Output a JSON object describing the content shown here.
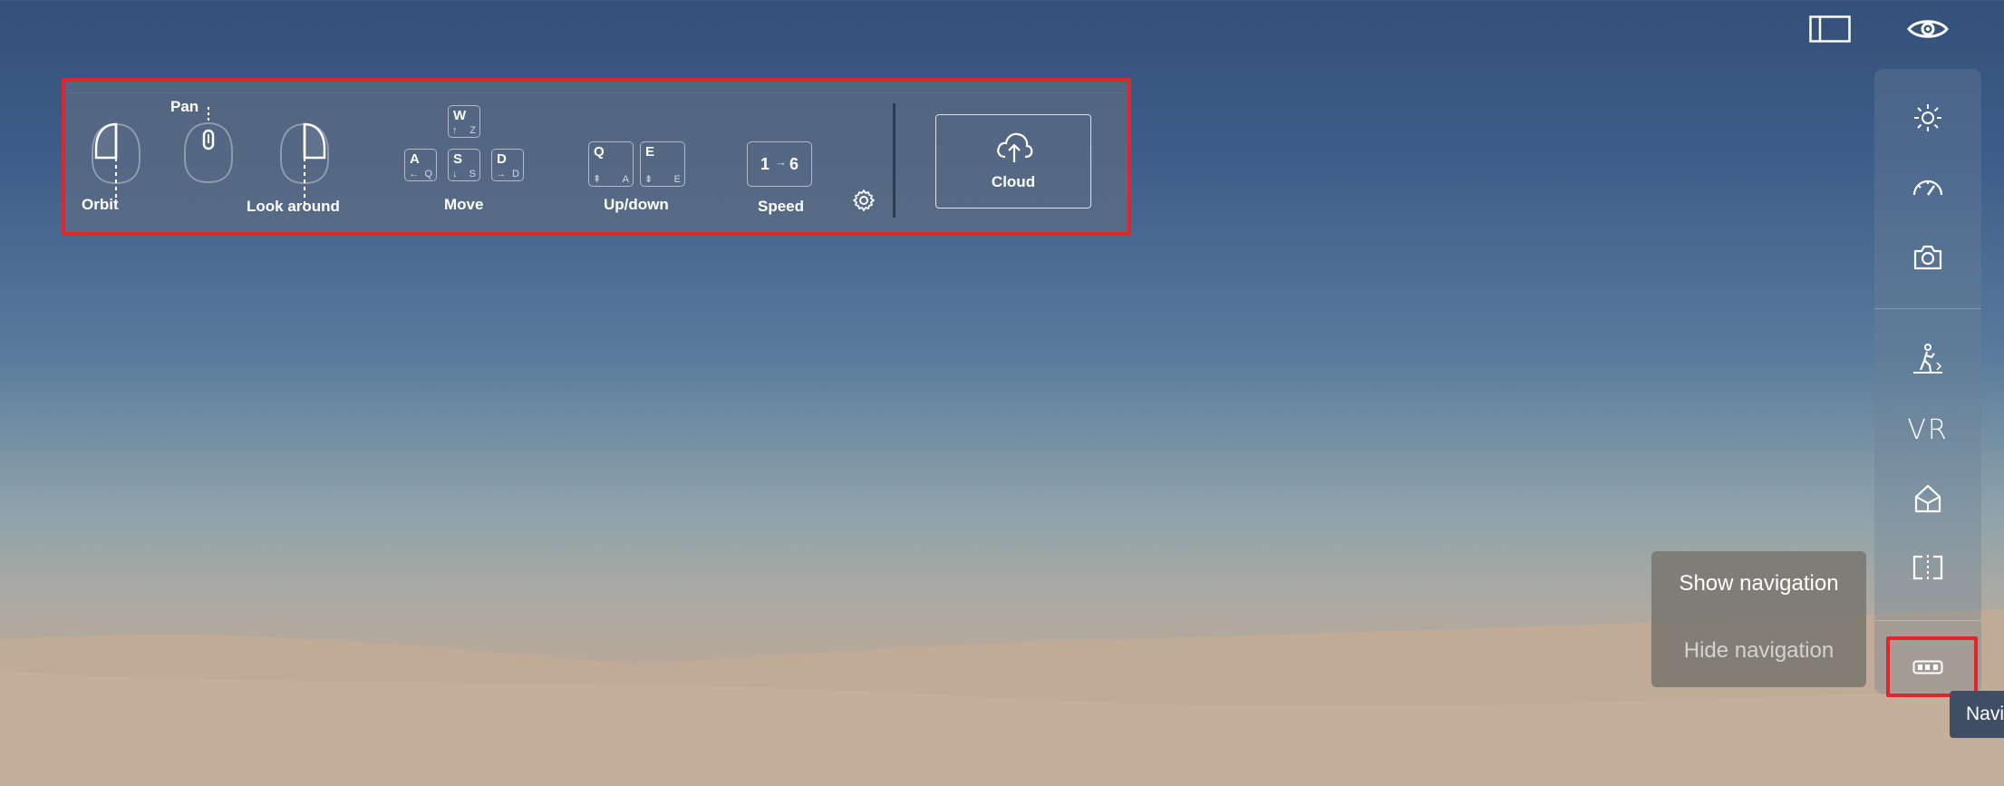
{
  "top_icons": [
    {
      "name": "panel-toggle-icon"
    },
    {
      "name": "eye-icon"
    }
  ],
  "navigation_help": {
    "orbit_label": "Orbit",
    "pan_label": "Pan",
    "look_around_label": "Look around",
    "move_label": "Move",
    "move_keys": {
      "w": {
        "main": "W",
        "sub": "Z",
        "arrow": "↑"
      },
      "a": {
        "main": "A",
        "sub": "Q",
        "arrow": "←"
      },
      "s": {
        "main": "S",
        "sub": "S",
        "arrow": "↓"
      },
      "d": {
        "main": "D",
        "sub": "D",
        "arrow": "→"
      }
    },
    "updown_label": "Up/down",
    "updown_keys": {
      "q": {
        "main": "Q",
        "sub": "A"
      },
      "e": {
        "main": "E",
        "sub": "E"
      }
    },
    "speed_label": "Speed",
    "speed_from": "1",
    "speed_to": "6",
    "cloud_label": "Cloud",
    "highlight_color": "#e0262c"
  },
  "right_toolbar": {
    "items": [
      {
        "name": "sun-icon"
      },
      {
        "name": "speedometer-icon"
      },
      {
        "name": "camera-icon"
      },
      {
        "name": "walk-icon"
      },
      {
        "name": "vr-icon",
        "label": "VR"
      },
      {
        "name": "house-icon"
      },
      {
        "name": "split-view-icon"
      },
      {
        "name": "navigation-keys-icon"
      }
    ]
  },
  "navigation_menu": {
    "show_label": "Show navigation",
    "hide_label": "Hide navigation"
  },
  "tooltip": {
    "text": "Navi"
  }
}
